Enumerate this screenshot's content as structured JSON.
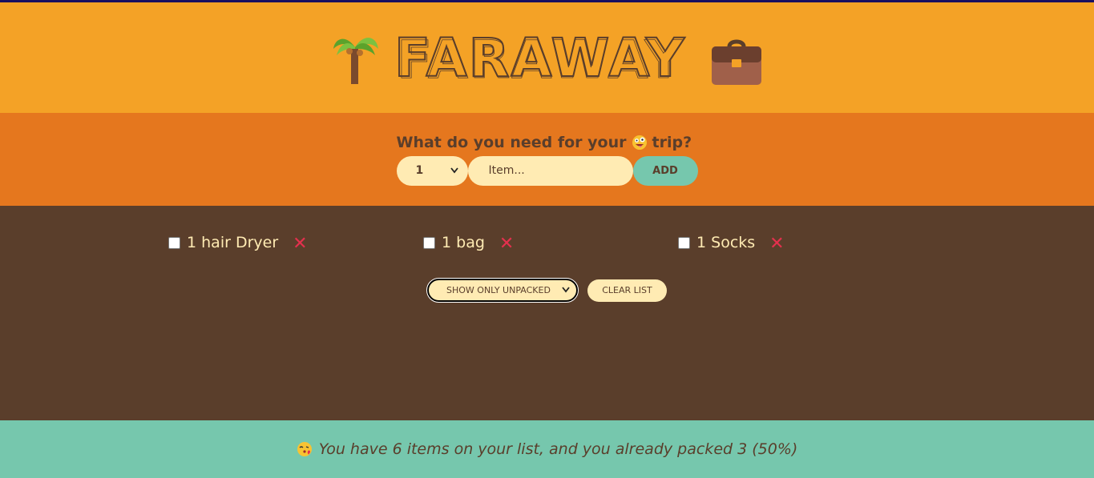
{
  "header": {
    "title": "FARAWAY",
    "left_icon": "palm-tree-icon",
    "right_icon": "briefcase-icon"
  },
  "form": {
    "question_prefix": "What do you need for your",
    "question_suffix": "trip?",
    "question_icon": "zany-face-icon",
    "quantity_value": "1",
    "item_placeholder": "Item...",
    "add_label": "ADD"
  },
  "items": [
    {
      "label": "1 hair Dryer",
      "checked": false
    },
    {
      "label": "1 bag",
      "checked": false
    },
    {
      "label": "1 Socks",
      "checked": false
    }
  ],
  "actions": {
    "sort_value": "SHOW ONLY UNPACKED",
    "clear_label": "CLEAR LIST"
  },
  "stats": {
    "icon": "face-blowing-kiss-icon",
    "text": "You have 6 items on your list, and you already packed 3 (50%)"
  },
  "colors": {
    "header_bg": "#f4a226",
    "form_bg": "#e5771e",
    "list_bg": "#5a3e2b",
    "stats_bg": "#76c7ad",
    "cream": "#ffebb3",
    "delete_red": "#e5304e"
  }
}
